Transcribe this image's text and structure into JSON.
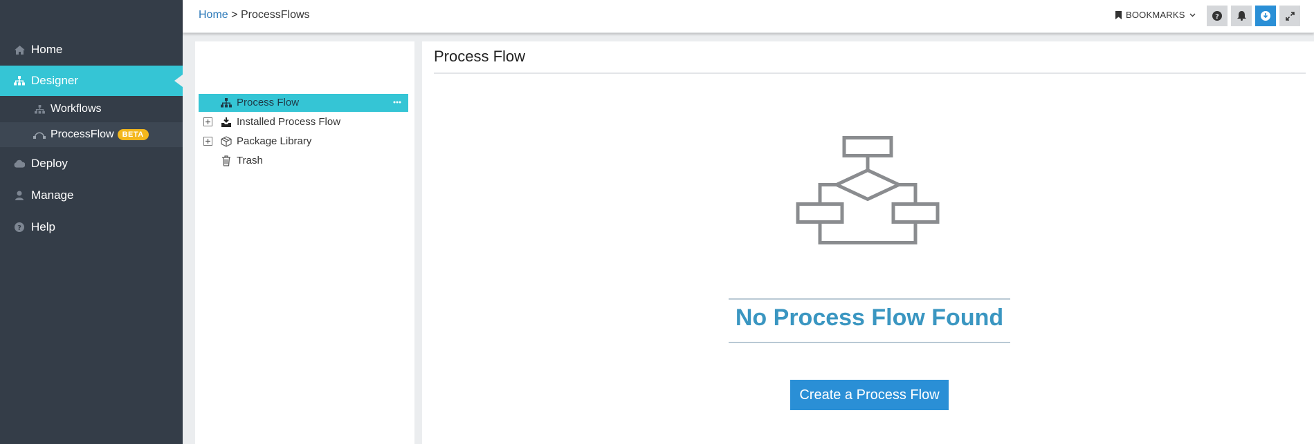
{
  "sidebar": {
    "items": [
      {
        "label": "Home",
        "icon": "home-icon"
      },
      {
        "label": "Designer",
        "icon": "sitemap-icon",
        "active": true
      },
      {
        "label": "Deploy",
        "icon": "cloud-icon"
      },
      {
        "label": "Manage",
        "icon": "user-icon"
      },
      {
        "label": "Help",
        "icon": "question-circle-icon"
      }
    ],
    "sub_items": [
      {
        "label": "Workflows",
        "icon": "sitemap-icon"
      },
      {
        "label": "ProcessFlow",
        "icon": "bezier-curve-icon",
        "badge": "BETA",
        "active": true
      }
    ]
  },
  "header": {
    "breadcrumb_home": "Home",
    "breadcrumb_separator": ">",
    "breadcrumb_current": "ProcessFlows",
    "bookmarks_label": "BOOKMARKS",
    "buttons": [
      "help-icon",
      "bell-icon",
      "download-icon",
      "expand-icon"
    ]
  },
  "tree": {
    "items": [
      {
        "label": "Process Flow",
        "icon": "sitemap-icon",
        "selected": true
      },
      {
        "label": "Installed Process Flow",
        "icon": "inbox-download-icon",
        "expandable": true
      },
      {
        "label": "Package Library",
        "icon": "package-icon",
        "expandable": true
      },
      {
        "label": "Trash",
        "icon": "trash-icon"
      }
    ]
  },
  "main": {
    "title": "Process Flow",
    "empty_message": "No Process Flow Found",
    "create_button": "Create a Process Flow"
  },
  "colors": {
    "sidebar_bg": "#343d48",
    "accent_cyan": "#35c5d5",
    "primary_blue": "#2a8fd6",
    "empty_title": "#3a96c1",
    "beta_badge": "#f3b71c"
  }
}
